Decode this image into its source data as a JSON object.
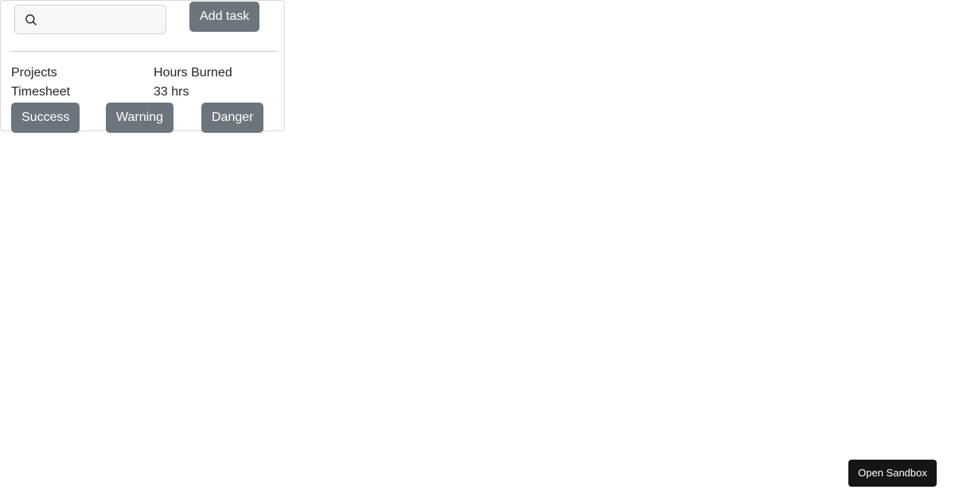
{
  "search": {
    "icon": "search-icon",
    "value": "",
    "placeholder": ""
  },
  "toolbar": {
    "add_task_label": "Add task"
  },
  "table": {
    "headers": [
      "Projects",
      "Hours Burned"
    ],
    "row": [
      "Timesheet",
      "33 hrs"
    ]
  },
  "actions": {
    "success_label": "Success",
    "warning_label": "Warning",
    "danger_label": "Danger"
  },
  "sandbox": {
    "label": "Open Sandbox"
  },
  "colors": {
    "button_secondary": "#6c757d",
    "sandbox_button": "#151515",
    "text": "#212529"
  }
}
